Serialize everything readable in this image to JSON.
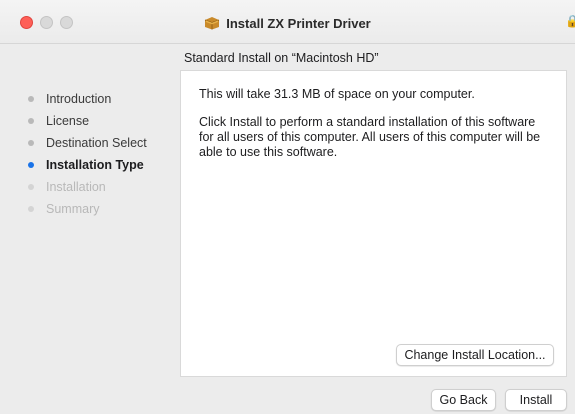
{
  "window": {
    "title": "Install ZX Printer Driver",
    "icons": {
      "app": "package-icon",
      "lock": "lock-icon"
    }
  },
  "sidebar": {
    "steps": [
      {
        "label": "Introduction",
        "state": "done"
      },
      {
        "label": "License",
        "state": "done"
      },
      {
        "label": "Destination Select",
        "state": "done"
      },
      {
        "label": "Installation Type",
        "state": "active"
      },
      {
        "label": "Installation",
        "state": "pending"
      },
      {
        "label": "Summary",
        "state": "pending"
      }
    ]
  },
  "main": {
    "heading": "Standard Install on “Macintosh HD”",
    "paragraph1": "This will take 31.3 MB of space on your computer.",
    "paragraph2": "Click Install to perform a standard installation of this software for all users of this computer. All users of this computer will be able to use this software.",
    "change_location_label": "Change Install Location..."
  },
  "footer": {
    "go_back_label": "Go Back",
    "install_label": "Install"
  },
  "colors": {
    "active_step": "#1a73e8",
    "close_button": "#fe5f57"
  }
}
